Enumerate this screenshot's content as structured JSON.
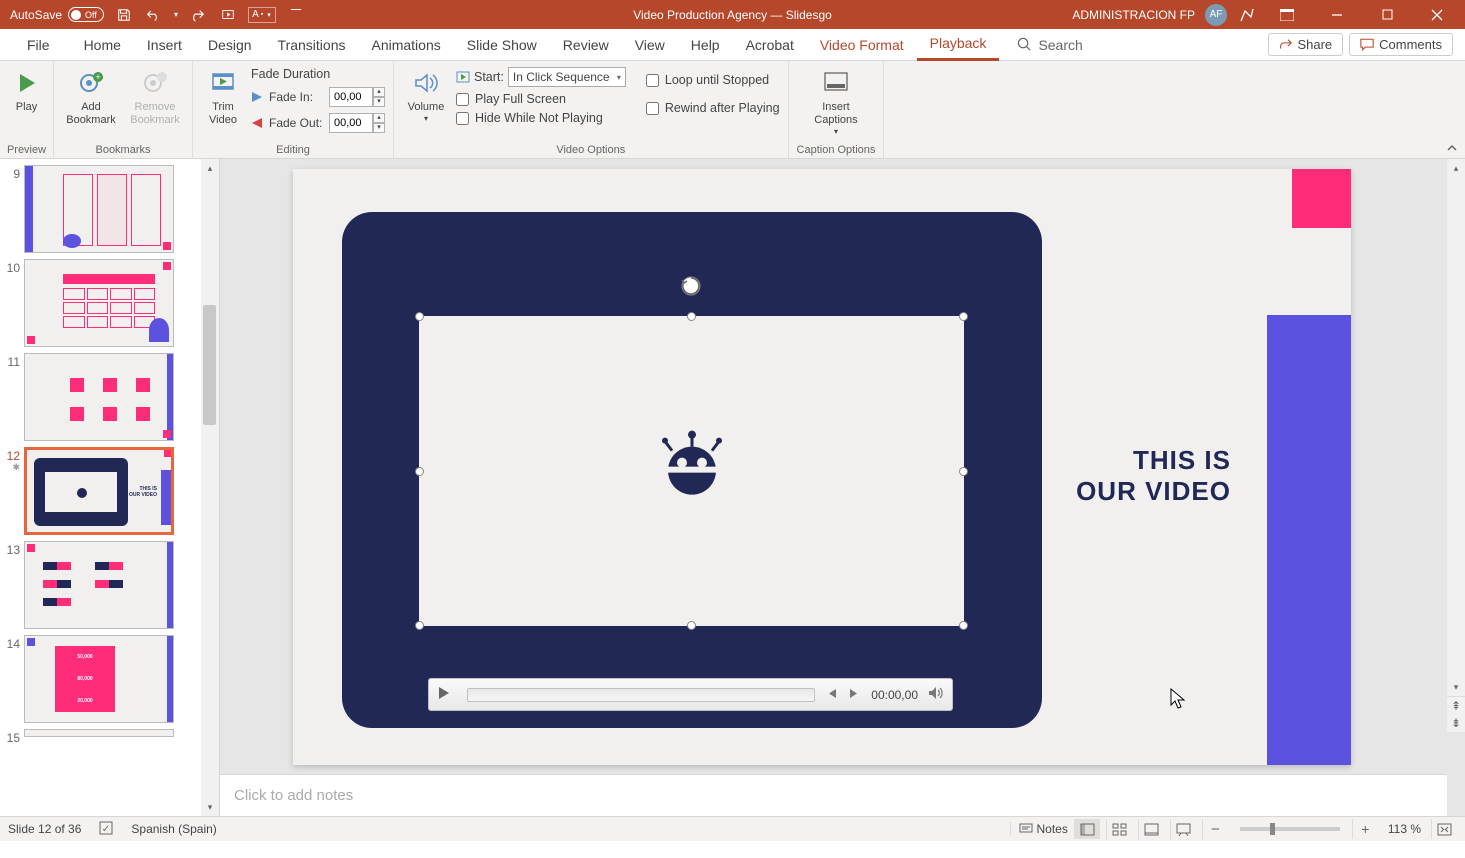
{
  "titlebar": {
    "autosave_label": "AutoSave",
    "autosave_state": "Off",
    "doc_title": "Video Production Agency — Slidesgo",
    "user_name": "ADMINISTRACION FP",
    "user_initials": "AF"
  },
  "tabs": {
    "file": "File",
    "home": "Home",
    "insert": "Insert",
    "design": "Design",
    "transitions": "Transitions",
    "animations": "Animations",
    "slideshow": "Slide Show",
    "review": "Review",
    "view": "View",
    "help": "Help",
    "acrobat": "Acrobat",
    "video_format": "Video Format",
    "playback": "Playback",
    "search": "Search",
    "share": "Share",
    "comments": "Comments"
  },
  "ribbon": {
    "preview": {
      "play": "Play",
      "group_label": "Preview"
    },
    "bookmarks": {
      "add": "Add Bookmark",
      "remove": "Remove Bookmark",
      "group_label": "Bookmarks"
    },
    "editing": {
      "trim": "Trim Video",
      "fade_duration": "Fade Duration",
      "fade_in": "Fade In:",
      "fade_out": "Fade Out:",
      "fade_in_val": "00,00",
      "fade_out_val": "00,00",
      "group_label": "Editing"
    },
    "video_options": {
      "volume": "Volume",
      "start_label": "Start:",
      "start_value": "In Click Sequence",
      "play_full": "Play Full Screen",
      "hide_while": "Hide While Not Playing",
      "loop": "Loop until Stopped",
      "rewind": "Rewind after Playing",
      "group_label": "Video Options"
    },
    "caption_options": {
      "insert_captions": "Insert Captions",
      "group_label": "Caption Options"
    }
  },
  "thumbnails": [
    {
      "num": "9"
    },
    {
      "num": "10"
    },
    {
      "num": "11"
    },
    {
      "num": "12",
      "selected": true,
      "animated": true
    },
    {
      "num": "13"
    },
    {
      "num": "14"
    },
    {
      "num": "15"
    }
  ],
  "slide": {
    "title_l1": "THIS IS",
    "title_l2": "OUR VIDEO",
    "video_time": "00:00,00"
  },
  "notes": {
    "placeholder": "Click to add notes"
  },
  "statusbar": {
    "slide_info": "Slide 12 of 36",
    "language": "Spanish (Spain)",
    "notes": "Notes",
    "zoom": "113 %"
  }
}
